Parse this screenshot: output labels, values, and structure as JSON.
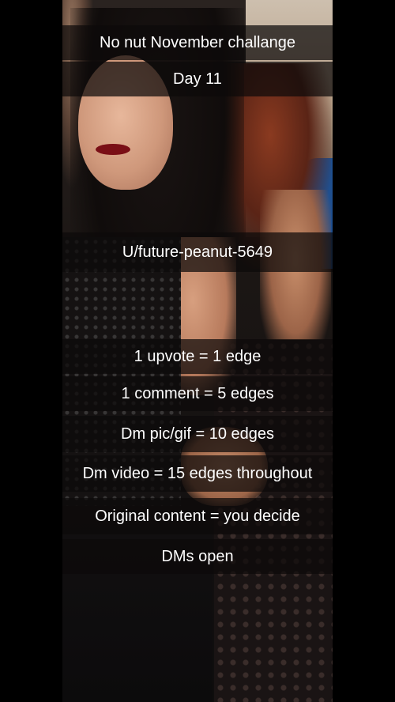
{
  "captions": {
    "title": "No nut November challange",
    "day": "Day 11",
    "username": "U/future-peanut-5649",
    "rule_upvote": "1 upvote = 1 edge",
    "rule_comment": "1 comment = 5 edges",
    "rule_dm_pic": "Dm pic/gif = 10 edges",
    "rule_dm_video": "Dm video = 15 edges throughout",
    "rule_original": "Original content = you decide",
    "dms_open": "DMs open"
  },
  "colors": {
    "caption_background": "#0c0a0a",
    "caption_text": "#ffffff",
    "lips": "#7a0f16",
    "letterbox": "#000000"
  }
}
